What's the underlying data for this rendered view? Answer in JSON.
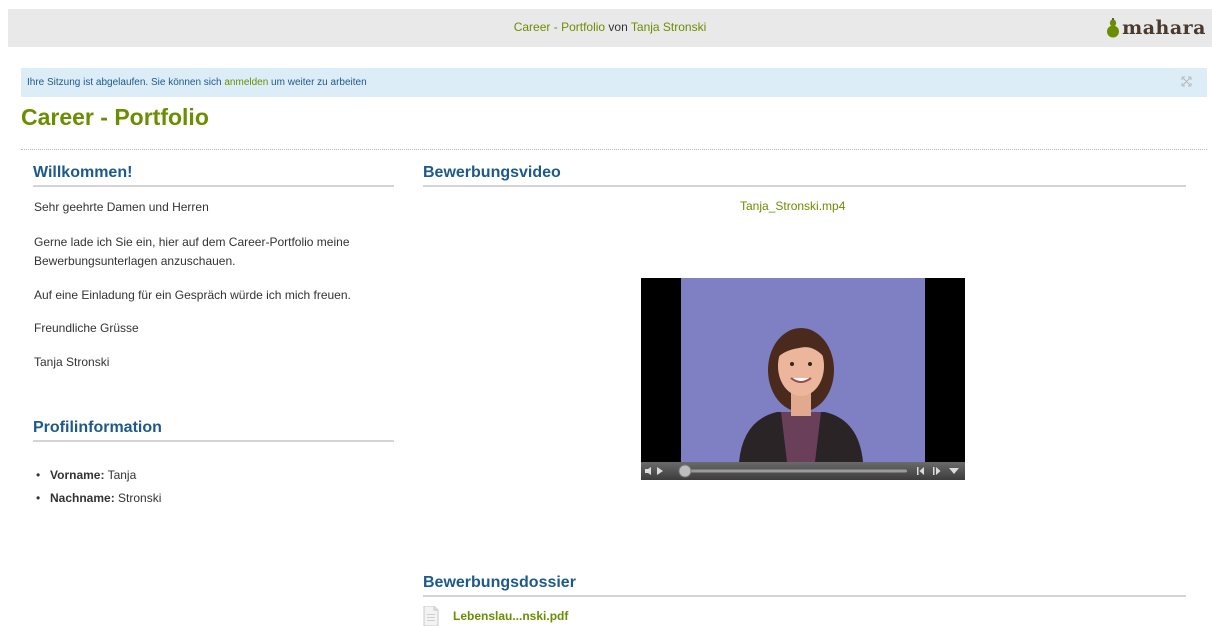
{
  "header": {
    "title_part1": "Career - Portfolio",
    "title_part2": " von ",
    "title_owner": "Tanja Stronski",
    "logo_text": "mahara"
  },
  "message": {
    "text_before": "Ihre Sitzung ist abgelaufen. Sie können sich ",
    "link": "anmelden",
    "text_after": " um weiter zu arbeiten"
  },
  "page": {
    "title": "Career - Portfolio"
  },
  "welcome": {
    "heading": "Willkommen!",
    "paragraphs": [
      "Sehr geehrte Damen und Herren",
      "Gerne lade ich Sie ein, hier auf dem Career-Portfolio meine",
      "Bewerbungsunterlagen anzuschauen.",
      "Auf eine Einladung für ein Gespräch würde ich mich freuen.",
      "Freundliche Grüsse",
      "Tanja Stronski"
    ]
  },
  "profile": {
    "heading": "Profilinformation",
    "items": [
      {
        "label": "Vorname:",
        "value": " Tanja"
      },
      {
        "label": "Nachname:",
        "value": " Stronski"
      }
    ]
  },
  "video_block": {
    "heading": "Bewerbungsvideo",
    "file": "Tanja_Stronski.mp4"
  },
  "dossier": {
    "heading": "Bewerbungsdossier",
    "file": "Lebenslau...nski.pdf"
  },
  "colors": {
    "accent_green": "#6b8e00",
    "heading_blue": "#1d5a8a",
    "message_bg": "#dcedf8",
    "header_bg": "#e9e9e9"
  }
}
